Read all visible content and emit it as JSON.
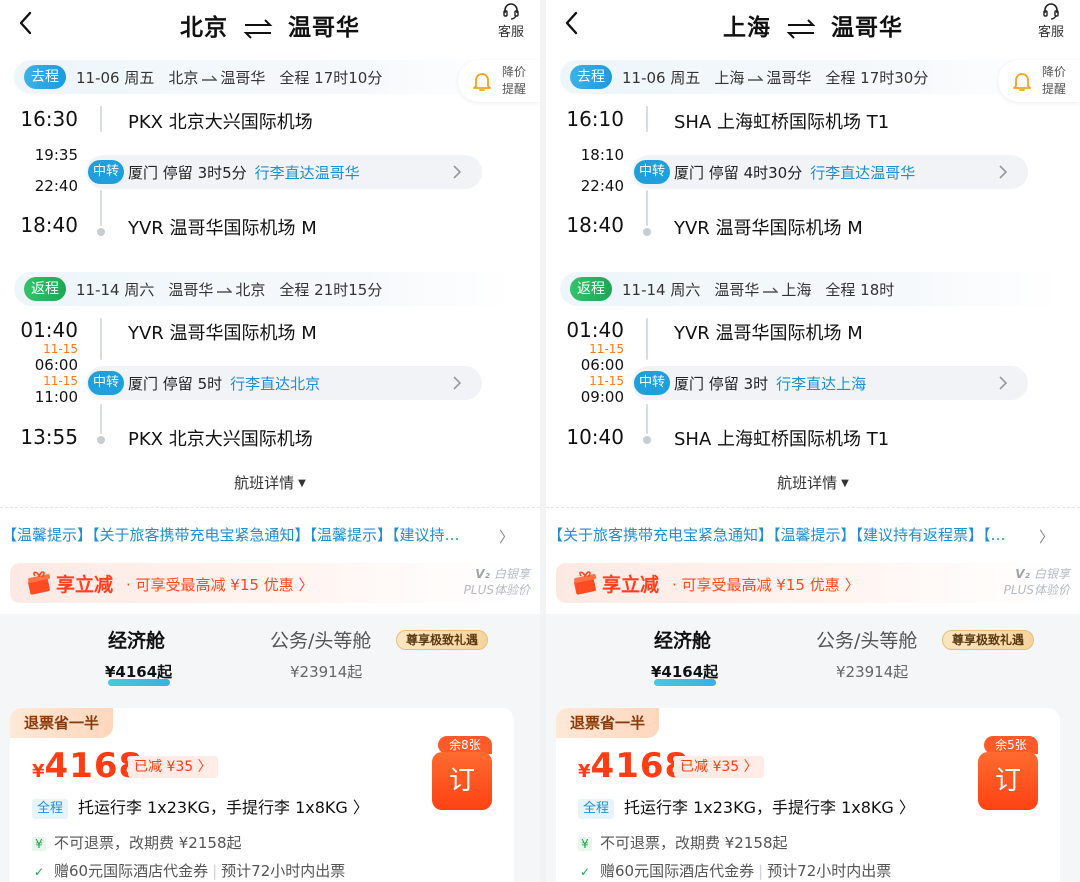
{
  "panels": [
    {
      "title": {
        "from": "北京",
        "to": "温哥华"
      },
      "service_label": "客服",
      "alert": {
        "line1": "降价",
        "line2": "提醒"
      },
      "outbound": {
        "badge": "去程",
        "date": "11-06 周五",
        "route_from": "北京",
        "route_to": "温哥华",
        "total": "全程 17时10分",
        "dep_time": "16:30",
        "dep_airport": "PKX 北京大兴国际机场",
        "arr_transfer_time": "19:35",
        "dep_transfer_time": "22:40",
        "arr_transfer_date": "",
        "dep_transfer_date": "",
        "transfer_badge": "中转",
        "transfer_city": "厦门",
        "stay": "停留 3时5分",
        "baggage": "行李直达温哥华",
        "arr_time": "18:40",
        "arr_airport": "YVR 温哥华国际机场 M"
      },
      "inbound": {
        "badge": "返程",
        "date": "11-14 周六",
        "route_from": "温哥华",
        "route_to": "北京",
        "total": "全程 21时15分",
        "dep_time": "01:40",
        "dep_airport": "YVR 温哥华国际机场 M",
        "arr_transfer_date": "11-15",
        "arr_transfer_time": "06:00",
        "dep_transfer_date": "11-15",
        "dep_transfer_time": "11:00",
        "transfer_badge": "中转",
        "transfer_city": "厦门",
        "stay": "停留 5时",
        "baggage": "行李直达北京",
        "arr_time": "13:55",
        "arr_airport": "PKX 北京大兴国际机场"
      },
      "details_label": "航班详情",
      "notice": "【温馨提示】【关于旅客携带充电宝紧急通知】【温馨提示】【建议持…",
      "promo": {
        "title": "享立减",
        "text": "· 可享受最高减 ¥15 优惠 〉"
      },
      "plus": {
        "line1": "白银享",
        "line2": "PLUS体验价"
      },
      "cabins": {
        "economy": "经济舱",
        "economy_price": "¥4164起",
        "business": "公务/头等舱",
        "business_price": "¥23914起",
        "vip_badge": "尊享极致礼遇"
      },
      "offer": {
        "refund_tag": "退票省一半",
        "currency": "¥",
        "price": "4168",
        "cut": "已减 ¥35 〉",
        "seats": "余8张",
        "book": "订",
        "bag_tag": "全程",
        "bag": "托运行李 1x23KG，手提行李 1x8KG 〉",
        "rule1": "不可退票，改期费 ¥2158起",
        "rule2a": "赠60元国际酒店代金券",
        "rule2b": "预计72小时内出票"
      }
    },
    {
      "title": {
        "from": "上海",
        "to": "温哥华"
      },
      "service_label": "客服",
      "alert": {
        "line1": "降价",
        "line2": "提醒"
      },
      "outbound": {
        "badge": "去程",
        "date": "11-06 周五",
        "route_from": "上海",
        "route_to": "温哥华",
        "total": "全程 17时30分",
        "dep_time": "16:10",
        "dep_airport": "SHA 上海虹桥国际机场 T1",
        "arr_transfer_time": "18:10",
        "dep_transfer_time": "22:40",
        "arr_transfer_date": "",
        "dep_transfer_date": "",
        "transfer_badge": "中转",
        "transfer_city": "厦门",
        "stay": "停留 4时30分",
        "baggage": "行李直达温哥华",
        "arr_time": "18:40",
        "arr_airport": "YVR 温哥华国际机场 M"
      },
      "inbound": {
        "badge": "返程",
        "date": "11-14 周六",
        "route_from": "温哥华",
        "route_to": "上海",
        "total": "全程 18时",
        "dep_time": "01:40",
        "dep_airport": "YVR 温哥华国际机场 M",
        "arr_transfer_date": "11-15",
        "arr_transfer_time": "06:00",
        "dep_transfer_date": "11-15",
        "dep_transfer_time": "09:00",
        "transfer_badge": "中转",
        "transfer_city": "厦门",
        "stay": "停留 3时",
        "baggage": "行李直达上海",
        "arr_time": "10:40",
        "arr_airport": "SHA 上海虹桥国际机场 T1"
      },
      "details_label": "航班详情",
      "notice": "【关于旅客携带充电宝紧急通知】【温馨提示】【建议持有返程票】【…",
      "promo": {
        "title": "享立减",
        "text": "· 可享受最高减 ¥15 优惠 〉"
      },
      "plus": {
        "line1": "白银享",
        "line2": "PLUS体验价"
      },
      "cabins": {
        "economy": "经济舱",
        "economy_price": "¥4164起",
        "business": "公务/头等舱",
        "business_price": "¥23914起",
        "vip_badge": "尊享极致礼遇"
      },
      "offer": {
        "refund_tag": "退票省一半",
        "currency": "¥",
        "price": "4168",
        "cut": "已减 ¥35 〉",
        "seats": "余5张",
        "book": "订",
        "bag_tag": "全程",
        "bag": "托运行李 1x23KG，手提行李 1x8KG 〉",
        "rule1": "不可退票，改期费 ¥2158起",
        "rule2a": "赠60元国际酒店代金券",
        "rule2b": "预计72小时内出票"
      }
    }
  ],
  "colors": {
    "accent_blue": "#1fa0dd",
    "price_red": "#ff3d14",
    "baggage_blue": "#1e8fd2",
    "date_orange": "#ff7a1a"
  },
  "icons": [
    "back-arrow-icon",
    "headset-icon",
    "swap-arrows-icon",
    "bell-icon",
    "chevron-right-icon",
    "gift-icon",
    "caret-down-icon",
    "check-icon",
    "yen-icon"
  ]
}
